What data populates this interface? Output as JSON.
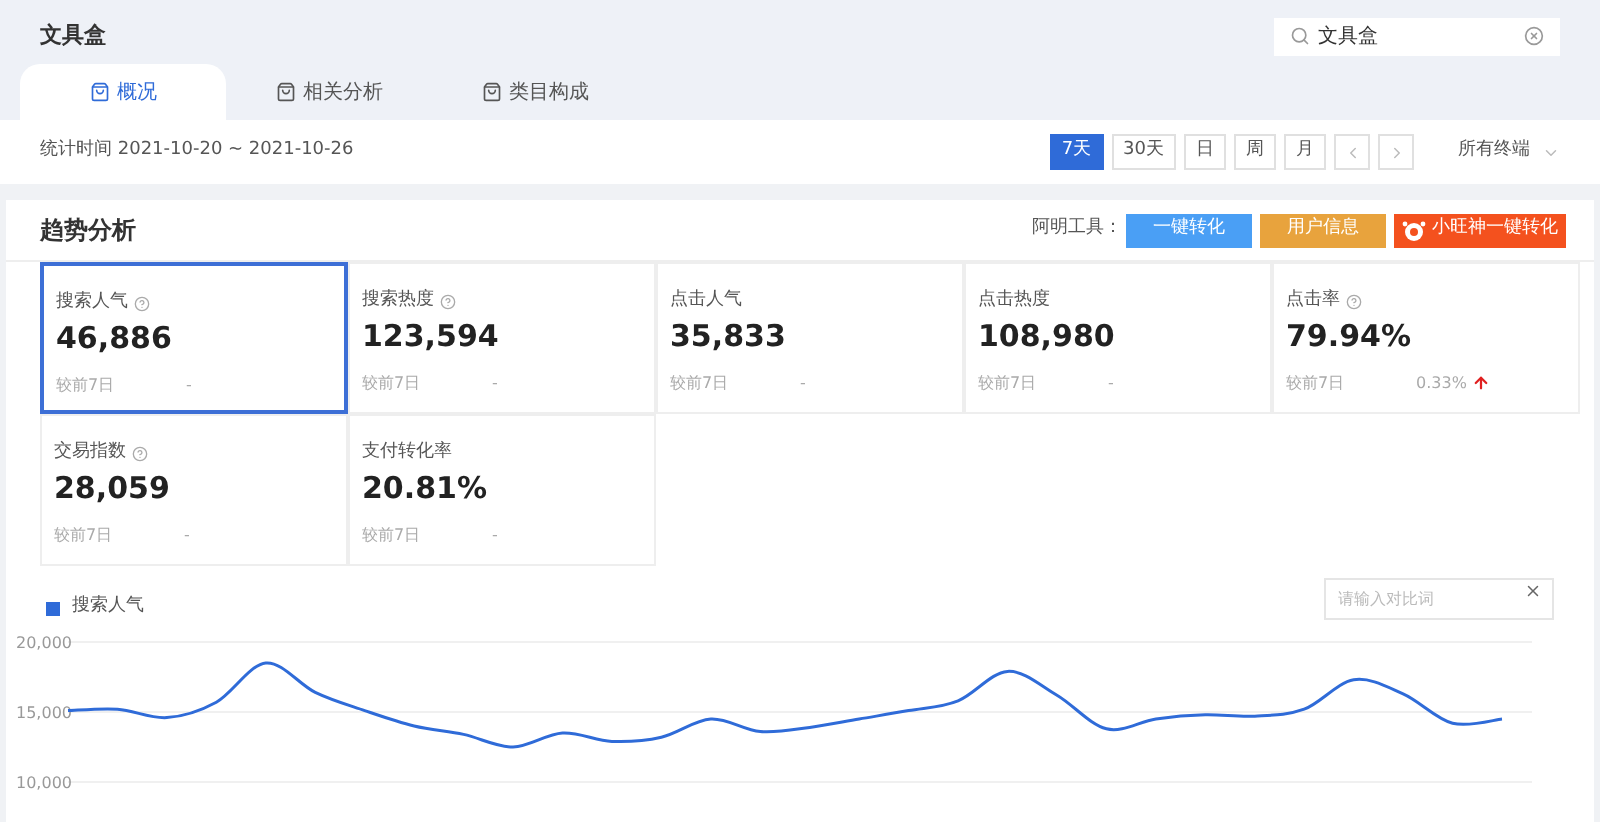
{
  "header": {
    "title": "文具盒",
    "search": {
      "value": "文具盒"
    }
  },
  "tabs": [
    {
      "label": "概况",
      "selected": true
    },
    {
      "label": "相关分析",
      "selected": false
    },
    {
      "label": "类目构成",
      "selected": false
    }
  ],
  "date_bar": {
    "range": "统计时间 2021-10-20 ~ 2021-10-26",
    "periods": [
      {
        "label": "7天",
        "selected": true
      },
      {
        "label": "30天",
        "selected": false
      },
      {
        "label": "日",
        "selected": false
      },
      {
        "label": "周",
        "selected": false
      },
      {
        "label": "月",
        "selected": false
      }
    ],
    "terminal": "所有终端"
  },
  "trend": {
    "title": "趋势分析",
    "tools_label": "阿明工具：",
    "tools": [
      {
        "label": "一键转化",
        "color": "#4a9ff5"
      },
      {
        "label": "用户信息",
        "color": "#e8a33d"
      },
      {
        "label": "小旺神一键转化",
        "color": "#f4511e"
      }
    ],
    "metrics": [
      {
        "label": "搜索人气",
        "help": true,
        "value": "46,886",
        "compare": "较前7日",
        "change": "-",
        "rising": false,
        "selected": true
      },
      {
        "label": "搜索热度",
        "help": true,
        "value": "123,594",
        "compare": "较前7日",
        "change": "-",
        "rising": false,
        "selected": false
      },
      {
        "label": "点击人气",
        "help": false,
        "value": "35,833",
        "compare": "较前7日",
        "change": "-",
        "rising": false,
        "selected": false
      },
      {
        "label": "点击热度",
        "help": false,
        "value": "108,980",
        "compare": "较前7日",
        "change": "-",
        "rising": false,
        "selected": false
      },
      {
        "label": "点击率",
        "help": true,
        "value": "79.94%",
        "compare": "较前7日",
        "change": "0.33%",
        "rising": true,
        "selected": false
      },
      {
        "label": "交易指数",
        "help": true,
        "value": "28,059",
        "compare": "较前7日",
        "change": "-",
        "rising": false,
        "selected": false
      },
      {
        "label": "支付转化率",
        "help": false,
        "value": "20.81%",
        "compare": "较前7日",
        "change": "-",
        "rising": false,
        "selected": false
      }
    ],
    "compare_field": {
      "placeholder": "请输入对比词"
    },
    "chart_data": {
      "type": "line",
      "ylim": [
        10000,
        20000
      ],
      "yticks": [
        {
          "value": 10000,
          "label": "10,000"
        },
        {
          "value": 15000,
          "label": "15,000"
        },
        {
          "value": 20000,
          "label": "20,000"
        }
      ],
      "series": [
        {
          "name": "搜索人气",
          "color": "#2f6bd8",
          "values": [
            15100,
            15200,
            14600,
            15700,
            18500,
            16400,
            15100,
            14000,
            13400,
            12500,
            13500,
            12900,
            13200,
            14500,
            13600,
            13900,
            14500,
            15100,
            15800,
            17900,
            16200,
            13800,
            14500,
            14800,
            14700,
            15200,
            17300,
            16300,
            14200,
            14500
          ]
        }
      ]
    }
  }
}
